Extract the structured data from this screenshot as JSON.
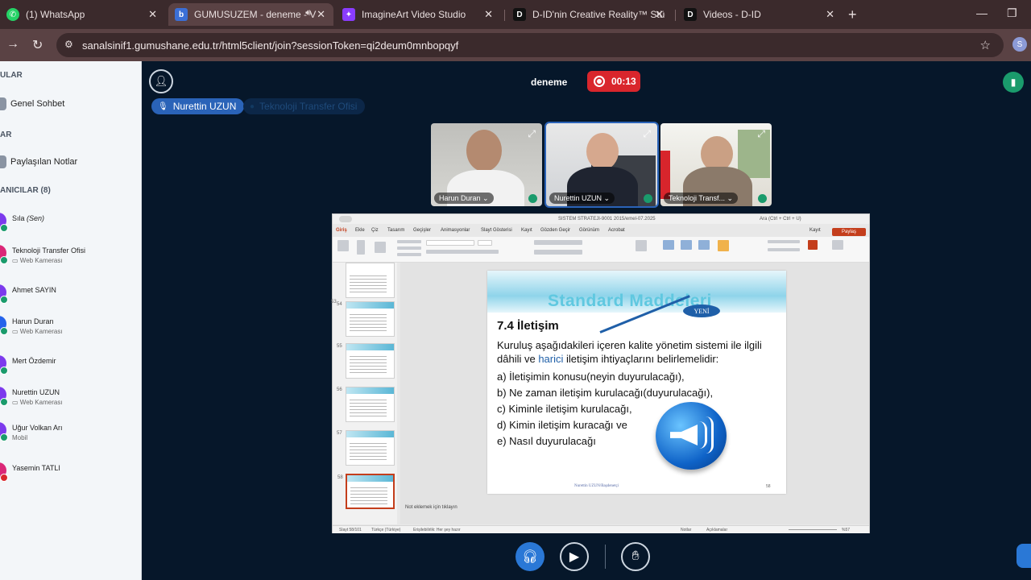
{
  "browser": {
    "tabs": [
      {
        "title": "(1) WhatsApp",
        "icon": "whatsapp-icon",
        "color": "#25d366",
        "active": false
      },
      {
        "title": "GUMUSUZEM - deneme - V",
        "icon": "bbb-icon",
        "color": "#3b6fd6",
        "active": true
      },
      {
        "title": "ImagineArt Video Studio",
        "icon": "imagineart-icon",
        "color": "#8a3cff",
        "active": false
      },
      {
        "title": "D-ID'nin Creative Reality™ Stüd",
        "icon": "did-icon",
        "color": "#111111",
        "active": false
      },
      {
        "title": "Videos - D-ID",
        "icon": "did-icon",
        "color": "#111111",
        "active": false
      }
    ],
    "url": "sanalsinif1.gumushane.edu.tr/html5client/join?sessionToken=qi2deum0mnbopqyf",
    "profile_initial": "S"
  },
  "sidebar": {
    "messages_title": "ULAR",
    "public_chat": "Genel Sohbet",
    "notes_title": "AR",
    "shared_notes": "Paylaşılan Notlar",
    "users_title": "ANICILAR (8)",
    "users": [
      {
        "name": "Sıla",
        "you": "(Sen)",
        "sub": "",
        "avatar": "#7c3aed",
        "mic": "#1a9b6c"
      },
      {
        "name": "Teknoloji Transfer Ofisi",
        "you": "",
        "sub": "▭ Web Kamerası",
        "avatar": "#db2777",
        "mic": "#1a9b6c"
      },
      {
        "name": "Ahmet SAYIN",
        "you": "",
        "sub": "",
        "avatar": "#7c3aed",
        "mic": "#1a9b6c"
      },
      {
        "name": "Harun Duran",
        "you": "",
        "sub": "▭ Web Kamerası",
        "avatar": "#2563eb",
        "mic": "#1a9b6c"
      },
      {
        "name": "Mert Özdemir",
        "you": "",
        "sub": "",
        "avatar": "#7c3aed",
        "mic": "#1a9b6c"
      },
      {
        "name": "Nurettin UZUN",
        "you": "",
        "sub": "▭ Web Kamerası",
        "avatar": "#7c3aed",
        "mic": "#1a9b6c"
      },
      {
        "name": "Uğur Volkan Arı",
        "you": "",
        "sub": "Mobil",
        "avatar": "#7c3aed",
        "mic": "#1a9b6c"
      },
      {
        "name": "Yasemin TATLI",
        "you": "",
        "sub": "",
        "avatar": "#db2777",
        "mic": "#d9262c"
      }
    ]
  },
  "meeting": {
    "title": "deneme",
    "recording_time": "00:13",
    "talkers": [
      "Nurettin UZUN",
      "Teknoloji Transfer Ofisi"
    ],
    "videos": [
      {
        "name": "Harun Duran ⌄"
      },
      {
        "name": "Nurettin UZUN ⌄"
      },
      {
        "name": "Teknoloji Transf... ⌄"
      }
    ]
  },
  "presentation": {
    "doc_title": "SISTEM STRATEJI-9001 2015/emel-07.2025",
    "search": "Ara (Ctrl + Ctrl + U)",
    "menu": [
      "Giriş",
      "Ekle",
      "Çiz",
      "Tasarım",
      "Geçişler",
      "Animasyonlar",
      "Slayt Gösterisi",
      "Kayıt",
      "Gözden Geçir",
      "Görünüm",
      "Acrobat"
    ],
    "record_label": "Kayıt",
    "share_label": "Paylaş",
    "thumb_numbers": [
      "53",
      "54",
      "55",
      "56",
      "57",
      "58"
    ],
    "slide": {
      "title": "Standard Maddeleri",
      "badge": "YENİ",
      "heading": "7.4 İletişim",
      "para_1": "Kuruluş aşağıdakileri içeren kalite yönetim sistemi ile ilgili dâhili ve ",
      "para_hl": "harici",
      "para_2": " iletişim ihtiyaçlarını belirlemelidir:",
      "items": [
        "a) İletişimin konusu(neyin duyurulacağı),",
        "b) Ne zaman iletişim kurulacağı(duyurulacağı),",
        "c) Kiminle iletişim kurulacağı,",
        "d) Kimin iletişim kuracağı ve",
        "e) Nasıl duyurulacağı"
      ],
      "footer": "Nurettin UZUN/Başdenetçi",
      "page": "58"
    },
    "notes_placeholder": "Not eklemek için tıklayın",
    "status_left": "Slayt 58/101",
    "status_lang": "Türkçe (Türkiye)",
    "status_access": "Erişilebilirlik: Her şey hazır",
    "status_notes": "Notlar",
    "status_comments": "Açıklamalar",
    "status_zoom": "%57"
  }
}
